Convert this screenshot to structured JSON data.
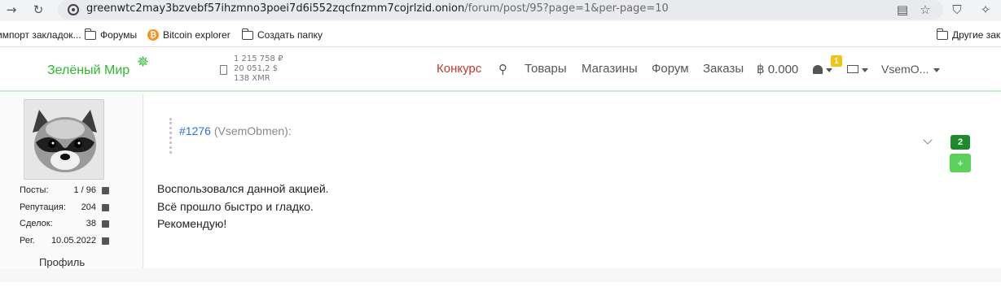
{
  "browser": {
    "url_host": "greenwtc2may3bzvebf57ihzmno3poei7d6i552zqcfnzmm7cojrlzid.onion",
    "url_path": "/forum/post/95?page=1&per-page=10",
    "bookmarks": [
      {
        "label": "импорт закладок...",
        "icon": "folder-icon"
      },
      {
        "label": "Форумы",
        "icon": "folder-icon"
      },
      {
        "label": "Bitcoin explorer",
        "icon": "bitcoin-icon"
      },
      {
        "label": "Создать папку",
        "icon": "folder-icon"
      }
    ],
    "other_bookmarks": "Другие зак"
  },
  "site": {
    "logo": "Зелёный Мир",
    "rates": [
      "1 215 758 ₽",
      "20 051,2 $",
      "138 XMR"
    ],
    "nav": {
      "contest": "Конкурс",
      "goods": "Товары",
      "shops": "Магазины",
      "forum": "Форум",
      "orders": "Заказы",
      "balance": "฿ 0.000"
    },
    "notifications_count": "1",
    "username": "VsemO..."
  },
  "author": {
    "stats": [
      {
        "label": "Посты:",
        "value": "1 / 96",
        "icon": "comment-icon"
      },
      {
        "label": "Репутация:",
        "value": "204",
        "icon": "thumbs-up-icon"
      },
      {
        "label": "Сделок:",
        "value": "38",
        "icon": "bag-icon"
      },
      {
        "label": "Рег.",
        "value": "10.05.2022",
        "icon": "calendar-icon"
      }
    ],
    "profile_link": "Профиль"
  },
  "post": {
    "quote_id": "#1276",
    "quote_author": "(VsemObmen):",
    "votes": "2",
    "vote_plus": "+",
    "lines": [
      "Воспользовался данной акцией.",
      "Всё прошло быстро и гладко.",
      "Рекомендую!"
    ]
  }
}
